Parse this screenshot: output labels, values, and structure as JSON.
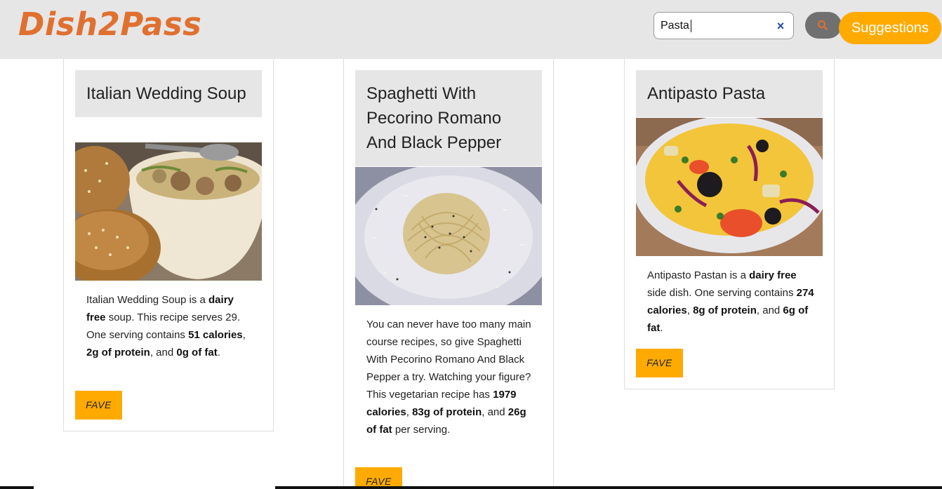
{
  "app": {
    "logo": "Dish2Pass"
  },
  "search": {
    "value": "Pasta",
    "clear_icon": "×",
    "icon": "search-icon"
  },
  "header": {
    "suggestions_label": "Suggestions"
  },
  "colors": {
    "accent": "#ffaa00",
    "logo": "#e07030",
    "header_bg": "#e6e6e6",
    "clear_icon": "#1e4ea8"
  },
  "cards": [
    {
      "title": "Italian Wedding Soup",
      "desc": [
        "Italian Wedding Soup is a ",
        "dairy free",
        " soup. This recipe serves 29. One serving contains ",
        "51 calories",
        ", ",
        "2g of protein",
        ", and ",
        "0g of fat",
        "."
      ],
      "fave": "FAVE"
    },
    {
      "title": "Spaghetti With Pecorino Romano And Black Pepper",
      "desc": [
        "You can never have too many main course recipes, so give Spaghetti With Pecorino Romano And Black Pepper a try. Watching your figure? This vegetarian recipe has ",
        "1979 calories",
        ", ",
        "83g of protein",
        ", and ",
        "26g of fat",
        " per serving."
      ],
      "fave": "FAVE"
    },
    {
      "title": "Antipasto Pasta",
      "desc": [
        "Antipasto Pastan is a ",
        "dairy free",
        " side dish. One serving contains ",
        "274 calories",
        ", ",
        "8g of protein",
        ", and ",
        "6g of fat",
        "."
      ],
      "fave": "FAVE"
    }
  ]
}
